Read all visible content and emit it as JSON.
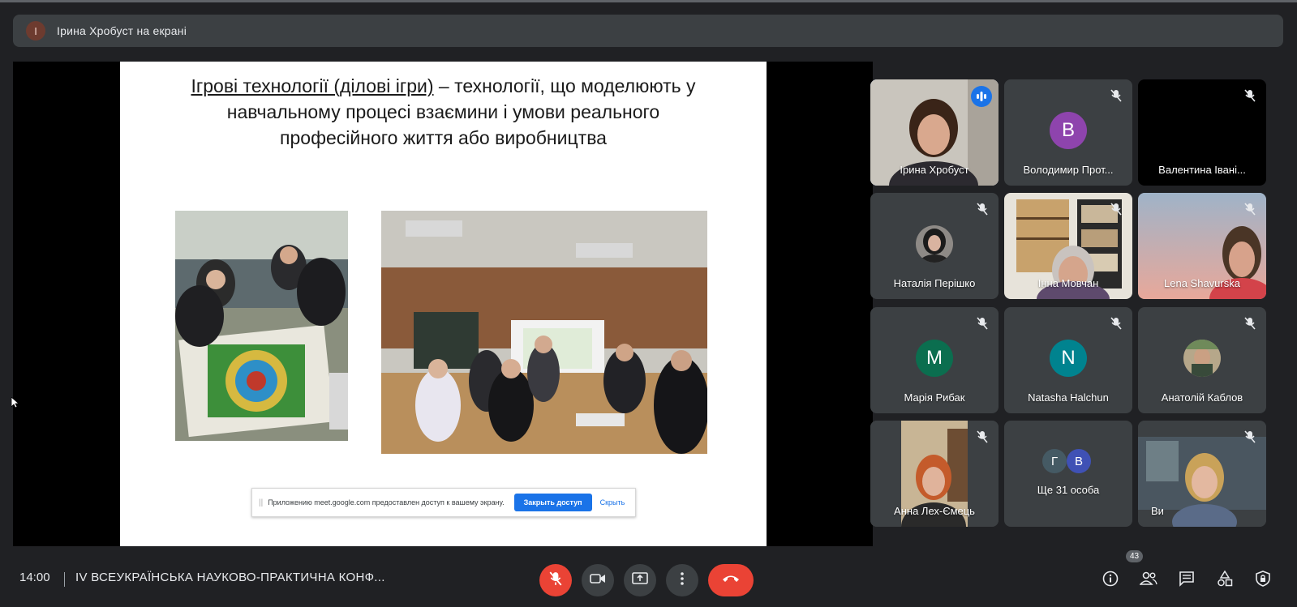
{
  "presenter": {
    "avatar_letter": "І",
    "text": "Ірина Хробуст на екрані"
  },
  "slide": {
    "title_underlined": "Ігрові технології (ділові ігри)",
    "title_rest_line1": " – технології, що моделюють у",
    "title_line2": "навчальному процесі взаємини і умови реального",
    "title_line3": "професійного життя або виробництва"
  },
  "share_banner": {
    "text": "Приложению meet.google.com предоставлен доступ к вашему экрану.",
    "stop_label": "Закрыть доступ",
    "hide_label": "Скрыть"
  },
  "participants": [
    {
      "name": "Ірина Хробуст",
      "state": "speaking"
    },
    {
      "name": "Володимир Протасов",
      "display": "Володимир Прот...",
      "avatar_letter": "В",
      "avatar_color": "#8e44ad"
    },
    {
      "name": "Валентина Іваніна",
      "display": "Валентина Івані..."
    },
    {
      "name": "Наталія Перішко"
    },
    {
      "name": "Інна Мовчан"
    },
    {
      "name": "Lena Shavurska"
    },
    {
      "name": "Марія Рибак",
      "avatar_letter": "М",
      "avatar_color": "#0b6e4f"
    },
    {
      "name": "Natasha Halchun",
      "avatar_letter": "N",
      "avatar_color": "#00838f"
    },
    {
      "name": "Анатолій Каблов"
    },
    {
      "name": "Анна Лех-Ємець"
    },
    {
      "name": "Ще 31 особа",
      "avatars": [
        "Г",
        "В"
      ]
    },
    {
      "name": "Ви"
    }
  ],
  "bottom_bar": {
    "time": "14:00",
    "meeting_title": "IV ВСЕУКРАЇНСЬКА НАУКОВО-ПРАКТИЧНА КОНФ...",
    "people_count": "43"
  },
  "colors": {
    "background": "#202124",
    "tile": "#3c4043",
    "accent_blue": "#1a73e8",
    "danger_red": "#ea4335"
  },
  "icons": [
    "mic-off-icon",
    "camera-icon",
    "present-screen-icon",
    "more-options-icon",
    "hang-up-icon",
    "info-icon",
    "people-icon",
    "chat-icon",
    "activities-icon",
    "host-controls-icon",
    "audio-wave-icon",
    "cursor-icon"
  ]
}
